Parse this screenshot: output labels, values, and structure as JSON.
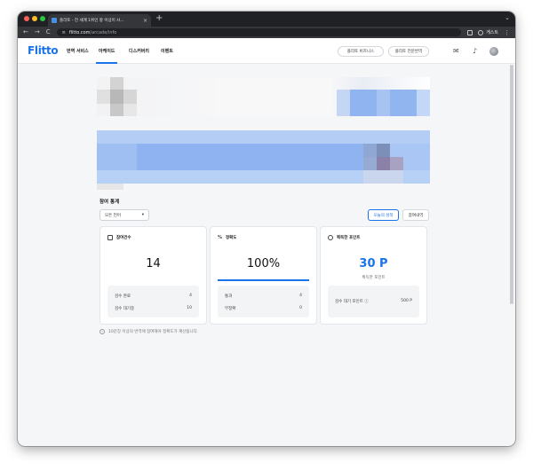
{
  "browser": {
    "tab_title": "플리토 - 전 세계 1위인 왕 이상이 사...",
    "tab_close": "×",
    "new_tab": "+",
    "tab_menu": "⌄",
    "back": "←",
    "forward": "→",
    "reload": "C",
    "url_host": "flitto.com",
    "url_path": "/arcade/info",
    "guest_label": "게스트",
    "menu": "⋮"
  },
  "header": {
    "logo": "Flitto",
    "nav": [
      "번역 서비스",
      "아케이드",
      "디스커버리",
      "이벤트"
    ],
    "business_button": "플리토 비즈니스",
    "expert_button": "플리토 전문번역"
  },
  "stats": {
    "section_title": "참여 통계",
    "language_select": "모든 언어",
    "select_caret": "▾",
    "today_button": "오늘의 성적",
    "history_button": "참여내역",
    "participation": {
      "title": "참여건수",
      "count": "14",
      "rows": [
        {
          "label": "검수 완료",
          "value": "4"
        },
        {
          "label": "검수 대기중",
          "value": "10"
        }
      ]
    },
    "accuracy": {
      "title": "정확도",
      "percent": "100%",
      "progress": 1.0,
      "rows": [
        {
          "label": "통과",
          "value": "4"
        },
        {
          "label": "부정확",
          "value": "0"
        }
      ]
    },
    "points": {
      "title": "획득한 포인트",
      "amount": "30 P",
      "sub": "획득한 포인트",
      "row": {
        "label": "검수 대기 포인트 ⓘ",
        "value": "500 P"
      }
    },
    "note": "10문장 이상의 번역에 참여해야 정확도가 계산됩니다.",
    "note_icon": "i"
  },
  "colors": {
    "accent": "#1a73e8",
    "chrome_dark": "#202124",
    "chrome_mid": "#35363a"
  }
}
